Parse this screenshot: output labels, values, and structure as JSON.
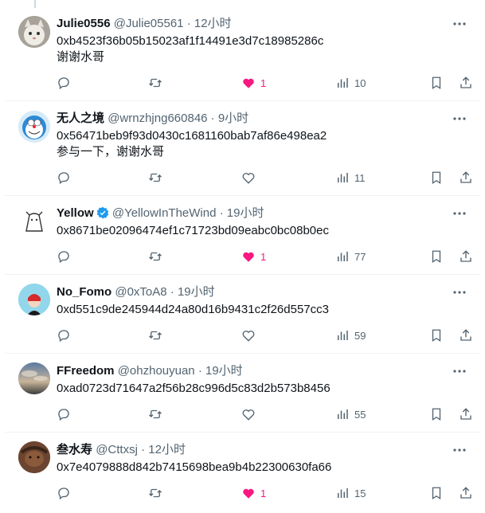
{
  "tweets": [
    {
      "name": "Julie0556",
      "handle": "@Julie05561",
      "sep": "·",
      "time": "12小时",
      "lines": [
        "0xb4523f36b05b15023af1f14491e3d7c18985286c",
        "谢谢水哥"
      ],
      "likes": "1",
      "liked": true,
      "views": "10",
      "verified": false
    },
    {
      "name": "无人之境",
      "handle": "@wrnzhjng660846",
      "sep": "·",
      "time": "9小时",
      "lines": [
        "0x56471beb9f93d0430c1681160bab7af86e498ea2",
        "参与一下，谢谢水哥"
      ],
      "likes": "",
      "liked": false,
      "views": "11",
      "verified": false
    },
    {
      "name": "Yellow",
      "handle": "@YellowInTheWind",
      "sep": "·",
      "time": "19小时",
      "lines": [
        "0x8671be02096474ef1c71723bd09eabc0bc08b0ec"
      ],
      "likes": "1",
      "liked": true,
      "views": "77",
      "verified": true
    },
    {
      "name": "No_Fomo",
      "handle": "@0xToA8",
      "sep": "·",
      "time": "19小时",
      "lines": [
        "0xd551c9de245944d24a80d16b9431c2f26d557cc3"
      ],
      "likes": "",
      "liked": false,
      "views": "59",
      "verified": false
    },
    {
      "name": "FFreedom",
      "handle": "@ohzhouyuan",
      "sep": "·",
      "time": "19小时",
      "lines": [
        "0xad0723d71647a2f56b28c996d5c83d2b573b8456"
      ],
      "likes": "",
      "liked": false,
      "views": "55",
      "verified": false
    },
    {
      "name": "叁水寿",
      "handle": "@Cttxsj",
      "sep": "·",
      "time": "12小时",
      "lines": [
        "0x7e4079888d842b7415698bea9b4b22300630fa66"
      ],
      "likes": "1",
      "liked": true,
      "views": "15",
      "verified": false
    }
  ],
  "colors": {
    "like": "#f91880",
    "muted": "#536471",
    "verified": "#1d9bf0"
  },
  "icons": [
    "reply-icon",
    "retweet-icon",
    "like-icon",
    "views-icon",
    "bookmark-icon",
    "share-icon",
    "more-icon",
    "verified-badge-icon"
  ]
}
